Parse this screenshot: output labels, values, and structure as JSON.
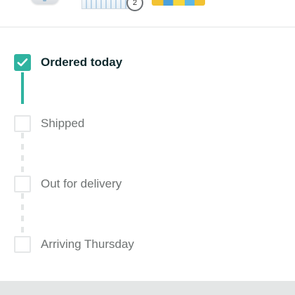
{
  "thumbnails": {
    "items": [
      {
        "name": "product-1"
      },
      {
        "name": "product-2",
        "badge": "2"
      },
      {
        "name": "product-3"
      }
    ]
  },
  "tracker": {
    "steps": [
      {
        "label": "Ordered today",
        "status": "complete"
      },
      {
        "label": "Shipped",
        "status": "pending"
      },
      {
        "label": "Out for delivery",
        "status": "pending"
      },
      {
        "label": "Arriving Thursday",
        "status": "pending"
      }
    ]
  },
  "colors": {
    "accent": "#2fb3a0",
    "pending_border": "#e5e7e8",
    "text_done": "#0f2a2e",
    "text_pending": "#6f7373"
  },
  "icons": {
    "check": "checkmark-icon"
  }
}
